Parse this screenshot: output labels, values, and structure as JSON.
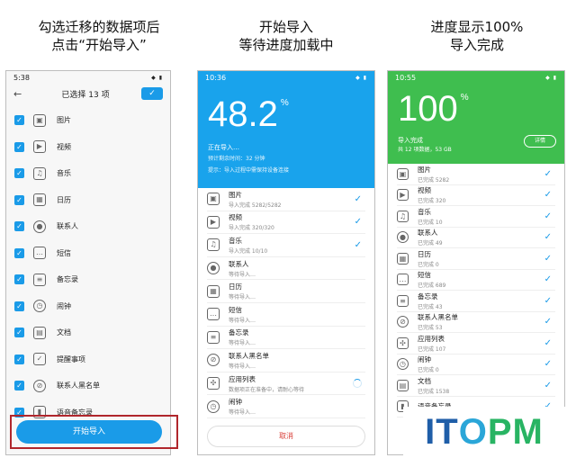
{
  "captions": [
    {
      "l1": "勾选迁移的数据项后",
      "l2": "点击“开始导入”"
    },
    {
      "l1": "开始导入",
      "l2": "等待进度加载中"
    },
    {
      "l1": "进度显示100%",
      "l2": "导入完成"
    }
  ],
  "p1": {
    "time": "5:38",
    "title": "已选择 13 项",
    "back": "←",
    "ok": "✓",
    "button": "开始导入",
    "items": [
      {
        "label": "图片",
        "icon": "image-icon"
      },
      {
        "label": "视频",
        "icon": "video-icon"
      },
      {
        "label": "音乐",
        "icon": "music-icon"
      },
      {
        "label": "日历",
        "icon": "calendar-icon"
      },
      {
        "label": "联系人",
        "icon": "contact-icon"
      },
      {
        "label": "短信",
        "icon": "message-icon"
      },
      {
        "label": "备忘录",
        "icon": "memo-icon"
      },
      {
        "label": "闹钟",
        "icon": "clock-icon"
      },
      {
        "label": "文档",
        "icon": "document-icon"
      },
      {
        "label": "提醒事项",
        "icon": "reminder-icon"
      },
      {
        "label": "联系人黑名单",
        "icon": "block-icon"
      },
      {
        "label": "语音备忘录",
        "icon": "mic-icon"
      }
    ]
  },
  "p2": {
    "time": "10:36",
    "percent": "48.2",
    "unit": "%",
    "status": "正在导入…",
    "remaining": "预计剩余时间：32 分钟",
    "tip": "提示：导入过程中需保持设备连接",
    "cancel": "取消",
    "items": [
      {
        "a": "图片",
        "b": "导入完成 5282/5282",
        "state": "done",
        "icon": "image-icon"
      },
      {
        "a": "视频",
        "b": "导入完成 320/320",
        "state": "done",
        "icon": "video-icon"
      },
      {
        "a": "音乐",
        "b": "导入完成 10/10",
        "state": "done",
        "icon": "music-icon"
      },
      {
        "a": "联系人",
        "b": "等待导入…",
        "state": "wait",
        "icon": "contact-icon"
      },
      {
        "a": "日历",
        "b": "等待导入…",
        "state": "wait",
        "icon": "calendar-icon"
      },
      {
        "a": "短信",
        "b": "等待导入…",
        "state": "wait",
        "icon": "message-icon"
      },
      {
        "a": "备忘录",
        "b": "等待导入…",
        "state": "wait",
        "icon": "memo-icon"
      },
      {
        "a": "联系人黑名单",
        "b": "等待导入…",
        "state": "wait",
        "icon": "block-icon"
      },
      {
        "a": "应用列表",
        "b": "数据项正在准备中，请耐心等待",
        "state": "loading",
        "icon": "apps-icon"
      },
      {
        "a": "闹钟",
        "b": "等待导入…",
        "state": "wait",
        "icon": "clock-icon"
      }
    ]
  },
  "p3": {
    "time": "10:55",
    "percent": "100",
    "unit": "%",
    "status": "导入完成",
    "summary": "共 12 项数据，53 GB",
    "details": "详情",
    "items": [
      {
        "a": "图片",
        "b": "已完成 5282",
        "icon": "image-icon"
      },
      {
        "a": "视频",
        "b": "已完成 320",
        "icon": "video-icon"
      },
      {
        "a": "音乐",
        "b": "已完成 10",
        "icon": "music-icon"
      },
      {
        "a": "联系人",
        "b": "已完成 49",
        "icon": "contact-icon"
      },
      {
        "a": "日历",
        "b": "已完成 0",
        "icon": "calendar-icon"
      },
      {
        "a": "短信",
        "b": "已完成 689",
        "icon": "message-icon"
      },
      {
        "a": "备忘录",
        "b": "已完成 43",
        "icon": "memo-icon"
      },
      {
        "a": "联系人黑名单",
        "b": "已完成 53",
        "icon": "block-icon"
      },
      {
        "a": "应用列表",
        "b": "已完成 107",
        "icon": "apps-icon"
      },
      {
        "a": "闹钟",
        "b": "已完成 0",
        "icon": "clock-icon"
      },
      {
        "a": "文档",
        "b": "已完成 1538",
        "icon": "document-icon"
      },
      {
        "a": "语音备忘录",
        "b": "",
        "icon": "mic-icon"
      }
    ]
  },
  "logo": {
    "text": "ITOPM",
    "colors": [
      "#1f5ea8",
      "#1f5ea8",
      "#2aa6d8",
      "#28b463",
      "#28b463"
    ]
  },
  "colors": {
    "blue": "#1a9be8",
    "green": "#3fbe4f",
    "red_box": "#b0262c"
  }
}
